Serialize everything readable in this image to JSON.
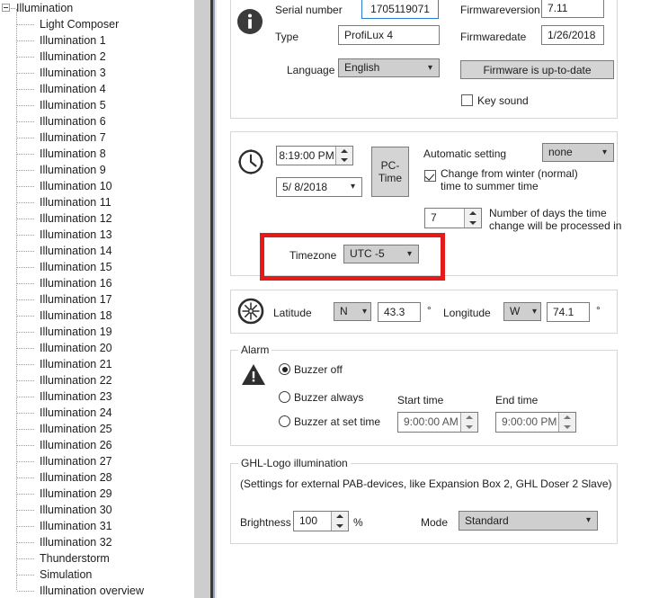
{
  "tree": {
    "root": "Illumination",
    "items": [
      "Light Composer",
      "Illumination 1",
      "Illumination 2",
      "Illumination 3",
      "Illumination 4",
      "Illumination 5",
      "Illumination 6",
      "Illumination 7",
      "Illumination 8",
      "Illumination 9",
      "Illumination 10",
      "Illumination 11",
      "Illumination 12",
      "Illumination 13",
      "Illumination 14",
      "Illumination 15",
      "Illumination 16",
      "Illumination 17",
      "Illumination 18",
      "Illumination 19",
      "Illumination 20",
      "Illumination 21",
      "Illumination 22",
      "Illumination 23",
      "Illumination 24",
      "Illumination 25",
      "Illumination 26",
      "Illumination 27",
      "Illumination 28",
      "Illumination 29",
      "Illumination 30",
      "Illumination 31",
      "Illumination 32",
      "Thunderstorm",
      "Simulation",
      "Illumination overview"
    ]
  },
  "device_panel": {
    "serial_label": "Serial number",
    "serial_value": "1705119071",
    "type_label": "Type",
    "type_value": "ProfiLux 4",
    "language_label": "Language",
    "language_value": "English",
    "firmware_version_label": "Firmwareversion",
    "firmware_version_value": "7.11",
    "firmware_date_label": "Firmwaredate",
    "firmware_date_value": "1/26/2018",
    "firmware_button": "Firmware is up-to-date",
    "key_sound_label": "Key sound",
    "key_sound_checked": false
  },
  "time_panel": {
    "time_value": "8:19:00 PM",
    "date_value": "5/ 8/2018",
    "pc_time_button_line1": "PC-",
    "pc_time_button_line2": "Time",
    "automatic_setting_label": "Automatic setting",
    "automatic_setting_value": "none",
    "dst_label_line1": "Change from winter (normal)",
    "dst_label_line2": "time to summer time",
    "dst_checked": true,
    "days_value": "7",
    "days_label_line1": "Number of days the time",
    "days_label_line2": "change will be processed in",
    "timezone_label": "Timezone",
    "timezone_value": "UTC -5"
  },
  "location_panel": {
    "latitude_label": "Latitude",
    "latitude_hemisphere": "N",
    "latitude_value": "43.3",
    "latitude_unit": "°",
    "longitude_label": "Longitude",
    "longitude_hemisphere": "W",
    "longitude_value": "74.1",
    "longitude_unit": "°"
  },
  "alarm_panel": {
    "title": "Alarm",
    "option_off": "Buzzer off",
    "option_always": "Buzzer always",
    "option_set_time": "Buzzer at set time",
    "selected": "Buzzer off",
    "start_time_label": "Start time",
    "start_time_value": "9:00:00 AM",
    "end_time_label": "End time",
    "end_time_value": "9:00:00 PM"
  },
  "ghl_panel": {
    "title": "GHL-Logo illumination",
    "subtitle": "(Settings for external PAB-devices,  like Expansion Box 2, GHL Doser 2 Slave)",
    "brightness_label": "Brightness",
    "brightness_value": "100",
    "percent_label": "%",
    "mode_label": "Mode",
    "mode_value": "Standard"
  },
  "highlight": {
    "color": "#e31b1b"
  },
  "icons": {
    "info": "info-icon",
    "clock": "clock-icon",
    "compass": "compass-icon",
    "warning": "warning-icon",
    "chevron": "⌄"
  }
}
